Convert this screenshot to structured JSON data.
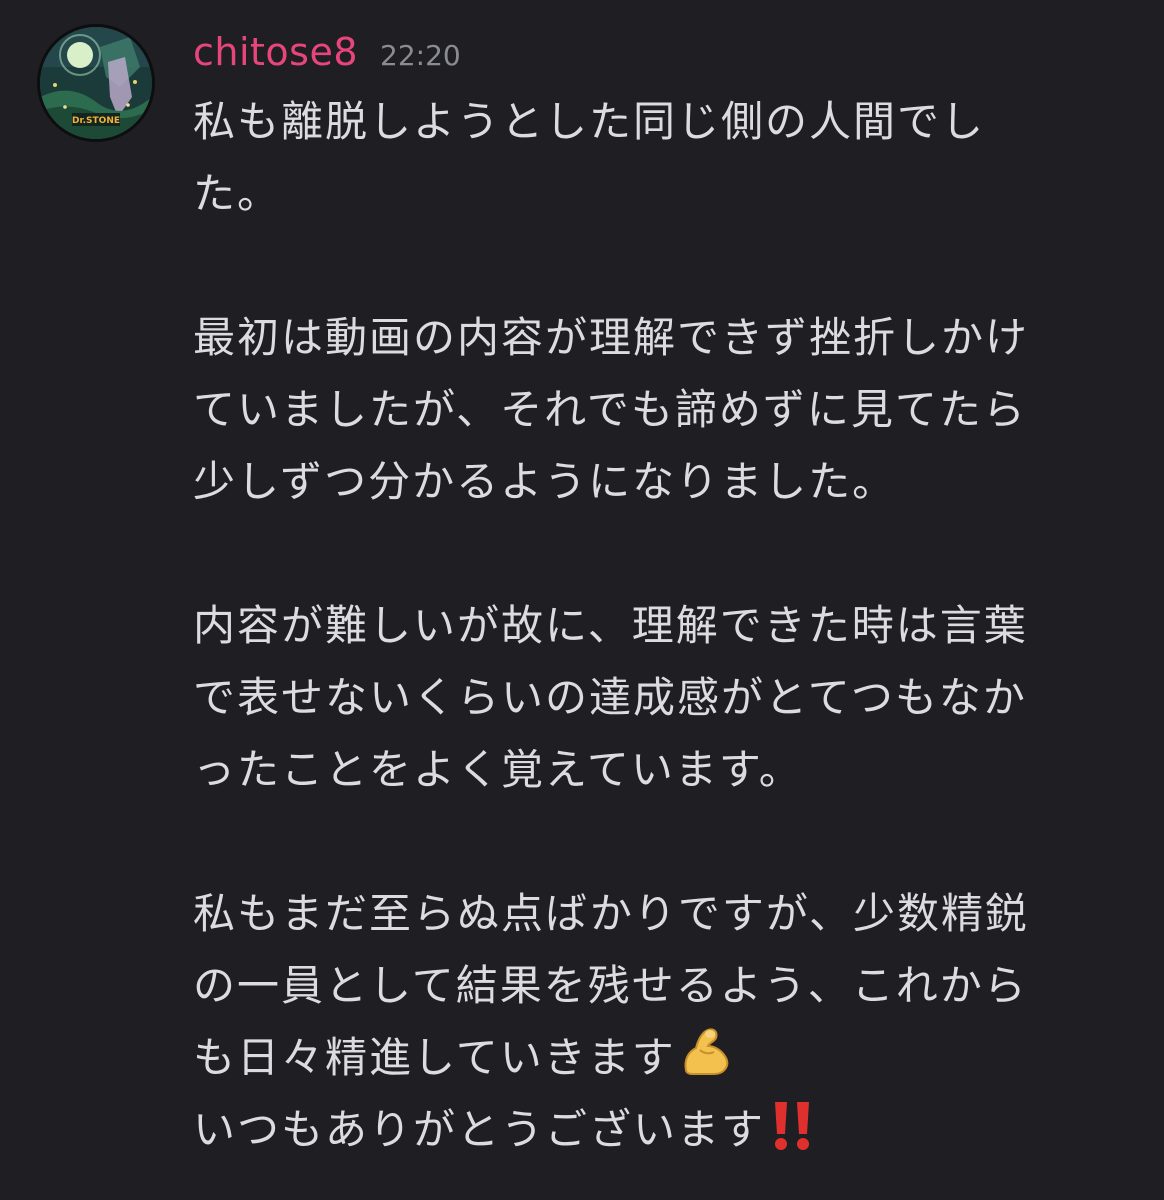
{
  "message": {
    "username": "chitose8",
    "timestamp": "22:20",
    "avatar_icon": "anime-moon-avatar-icon",
    "username_color": "#e8457a",
    "paragraphs": [
      {
        "lines": [
          "私も離脱しようとした同じ側の人間でし",
          "た。"
        ]
      },
      {
        "lines": [
          "最初は動画の内容が理解できず挫折しかけ",
          "ていましたが、それでも諦めずに見てたら",
          "少しずつ分かるようになりました。"
        ]
      },
      {
        "lines": [
          "内容が難しいが故に、理解できた時は言葉",
          "で表せないくらいの達成感がとてつもなか",
          "ったことをよく覚えています。"
        ]
      },
      {
        "lines": [
          "私もまだ至らぬ点ばかりですが、少数精鋭",
          "の一員として結果を残せるよう、これから",
          "も日々精進していきます"
        ]
      }
    ],
    "final_line": "いつもありがとうございます",
    "emojis": {
      "muscle": "flexed-biceps-icon",
      "exclamation": "double-exclamation-icon"
    }
  }
}
